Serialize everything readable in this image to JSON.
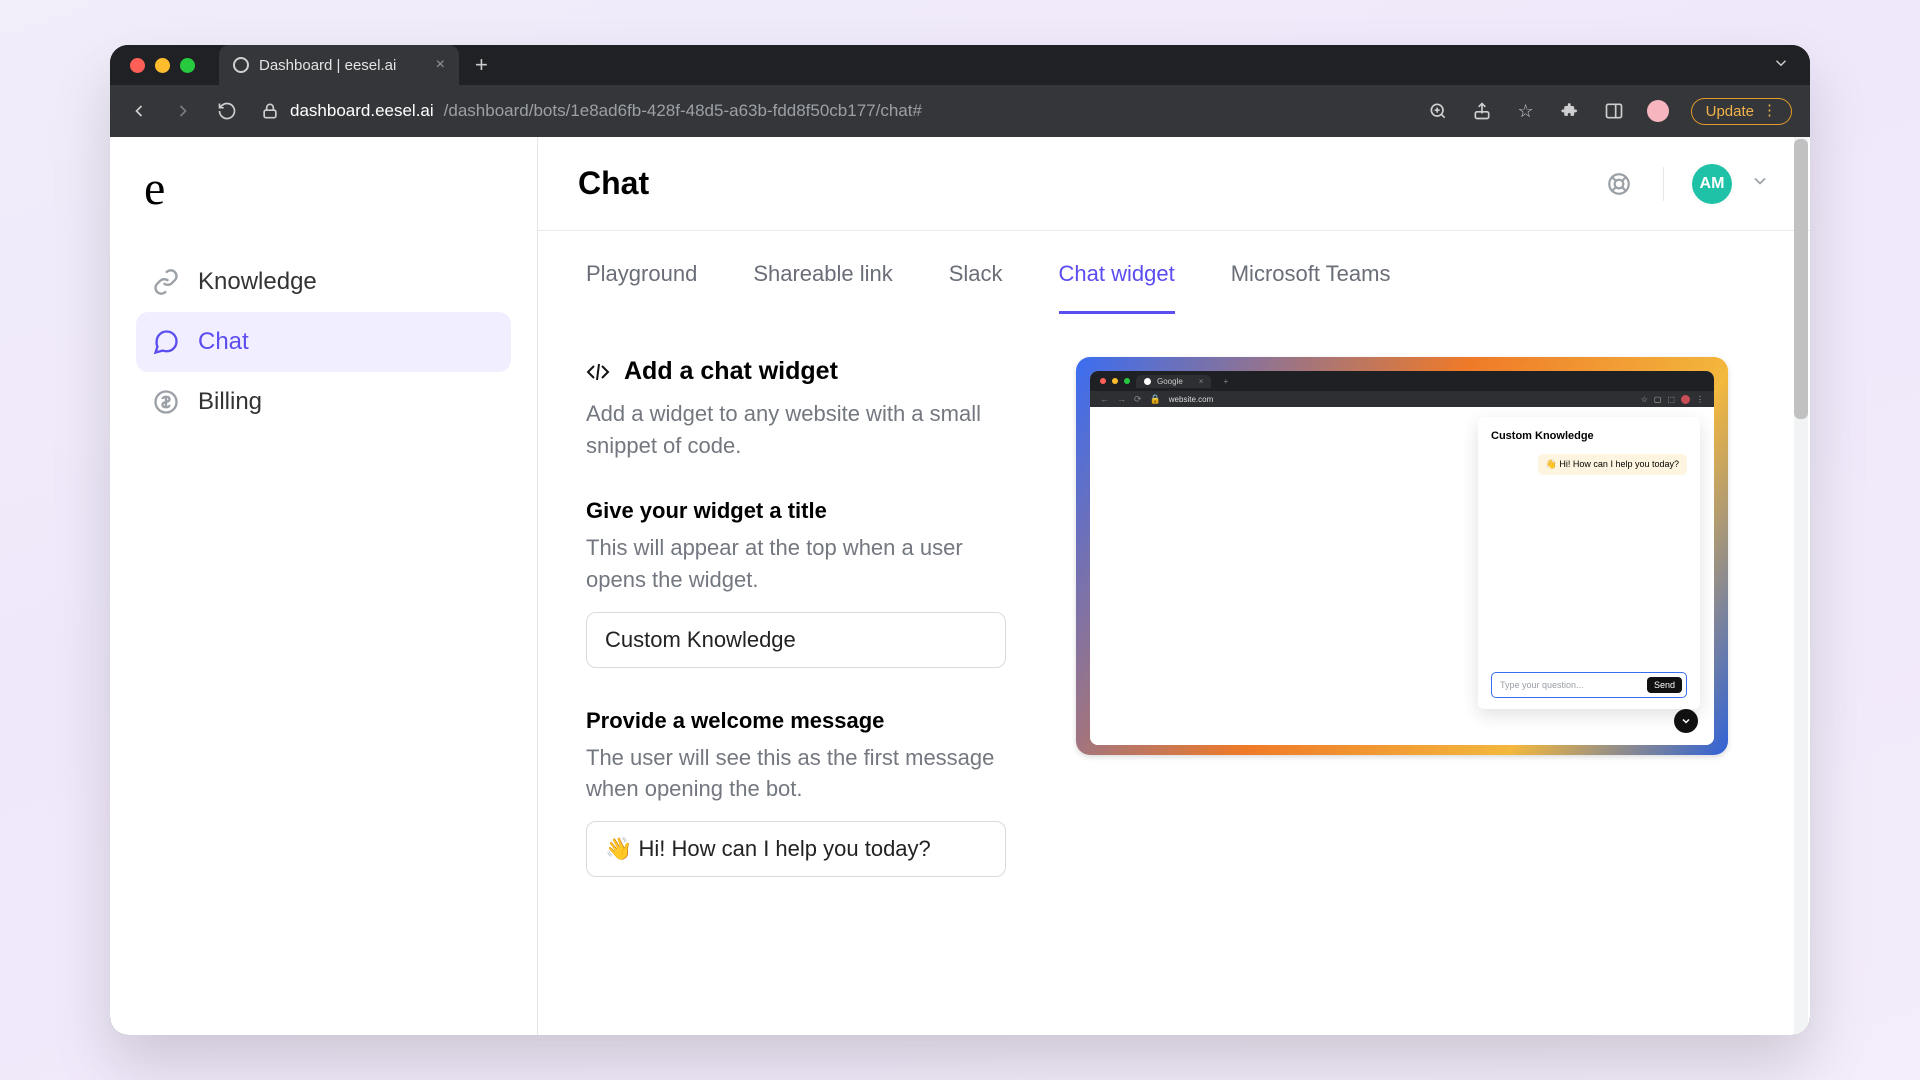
{
  "browser": {
    "tab_title": "Dashboard | eesel.ai",
    "url_host": "dashboard.eesel.ai",
    "url_path": "/dashboard/bots/1e8ad6fb-428f-48d5-a63b-fdd8f50cb177/chat#",
    "update_label": "Update"
  },
  "sidebar": {
    "logo": "e",
    "items": [
      {
        "label": "Knowledge"
      },
      {
        "label": "Chat"
      },
      {
        "label": "Billing"
      }
    ]
  },
  "header": {
    "title": "Chat",
    "avatar_initials": "AM"
  },
  "tabs": [
    "Playground",
    "Shareable link",
    "Slack",
    "Chat widget",
    "Microsoft Teams"
  ],
  "add_widget": {
    "heading": "Add a chat widget",
    "desc": "Add a widget to any website with a small snippet of code."
  },
  "title_field": {
    "label": "Give your widget a title",
    "desc": "This will appear at the top when a user opens the widget.",
    "value": "Custom Knowledge"
  },
  "welcome_field": {
    "label": "Provide a welcome message",
    "desc": "The user will see this as the first message when opening the bot.",
    "value": "👋 Hi! How can I help you today?"
  },
  "preview": {
    "tab_title": "Google",
    "url": "website.com",
    "widget_title": "Custom Knowledge",
    "greeting": "👋 Hi! How can I help you today?",
    "input_placeholder": "Type your question...",
    "send_label": "Send"
  }
}
